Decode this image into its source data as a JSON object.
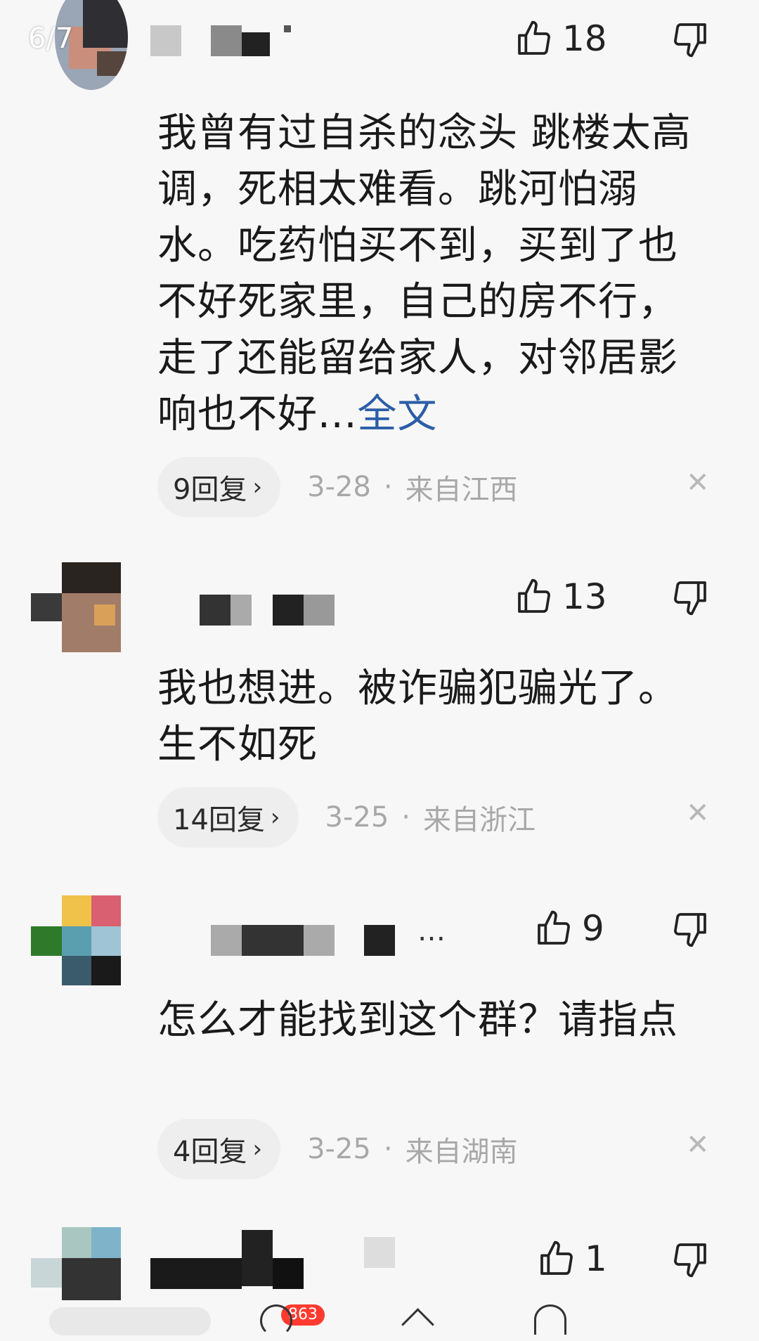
{
  "header": {
    "page_indicator": "6/7"
  },
  "comments": [
    {
      "likes": "18",
      "text": "我曾有过自杀的念头 跳楼太高调，死相太难看。跳河怕溺水。吃药怕买不到，买到了也不好死家里，自己的房不行，走了还能留给家人，对邻居影响也不好...",
      "fulltext_label": "全文",
      "replies": "9回复",
      "date": "3-28",
      "separator": "·",
      "location": "来自江西",
      "close": "✕"
    },
    {
      "likes": "13",
      "text": "我也想进。被诈骗犯骗光了。生不如死",
      "replies": "14回复",
      "date": "3-25",
      "separator": "·",
      "location": "来自浙江",
      "close": "✕"
    },
    {
      "likes": "9",
      "username_suffix": "…",
      "text": "怎么才能找到这个群？请指点",
      "replies": "4回复",
      "date": "3-25",
      "separator": "·",
      "location": "来自湖南",
      "close": "✕"
    },
    {
      "likes": "1"
    }
  ],
  "bottom_bar": {
    "badge": "863"
  },
  "colors": {
    "link": "#2b5ea8",
    "meta_gray": "#a8a8a8",
    "pill_bg": "#eeeeee",
    "background": "#f7f7f7"
  },
  "icons": {
    "like": "thumbs-up-icon",
    "dislike": "thumbs-down-icon",
    "chevron": "chevron-right-icon",
    "close": "close-icon"
  }
}
